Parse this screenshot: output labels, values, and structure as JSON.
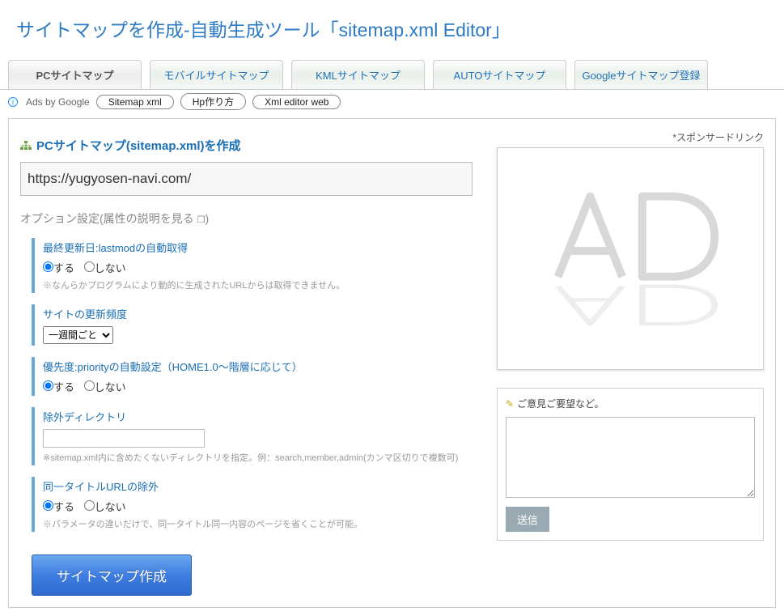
{
  "header": {
    "title": "サイトマップを作成-自動生成ツール「sitemap.xml Editor」"
  },
  "tabs": [
    {
      "label": "PCサイトマップ",
      "active": true
    },
    {
      "label": "モバイルサイトマップ",
      "active": false
    },
    {
      "label": "KMLサイトマップ",
      "active": false
    },
    {
      "label": "AUTOサイトマップ",
      "active": false
    },
    {
      "label": "Googleサイトマップ登録",
      "active": false
    }
  ],
  "ads_row": {
    "label": "Ads by Google",
    "pills": [
      "Sitemap xml",
      "Hp作り方",
      "Xml editor web"
    ]
  },
  "main": {
    "section_title": "PCサイトマップ(sitemap.xml)を作成",
    "url_value": "https://yugyosen-navi.com/",
    "options_heading_prefix": "オプション設定(",
    "options_heading_link": "属性の説明を見る",
    "options_heading_suffix": ")",
    "lastmod": {
      "title": "最終更新日:lastmodの自動取得",
      "opt_yes": "する",
      "opt_no": "しない",
      "note": "※なんらかプログラムにより動的に生成されたURLからは取得できません。"
    },
    "freq": {
      "title": "サイトの更新頻度",
      "selected": "一週間ごと"
    },
    "priority": {
      "title": "優先度:priorityの自動設定（HOME1.0～階層に応じて）",
      "opt_yes": "する",
      "opt_no": "しない"
    },
    "exclude": {
      "title": "除外ディレクトリ",
      "value": "",
      "note": "※sitemap.xml内に含めたくないディレクトリを指定。例：search,member,admin(カンマ区切りで複数可)"
    },
    "sametitle": {
      "title": "同一タイトルURLの除外",
      "opt_yes": "する",
      "opt_no": "しない",
      "note": "※パラメータの違いだけで、同一タイトル同一内容のページを省くことが可能。"
    },
    "create_button": "サイトマップ作成"
  },
  "side": {
    "sponsor_label": "*スポンサードリンク",
    "feedback_title": "ご意見ご要望など。",
    "feedback_value": "",
    "send_button": "送信"
  }
}
